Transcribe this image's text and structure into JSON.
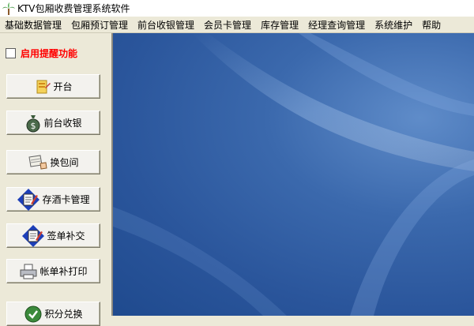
{
  "window": {
    "title": "KTV包厢收费管理系统软件"
  },
  "menu": [
    "基础数据管理",
    "包厢预订管理",
    "前台收银管理",
    "会员卡管理",
    "库存管理",
    "经理查询管理",
    "系统维护",
    "帮助"
  ],
  "sidebar": {
    "reminder_label": "启用提醒功能",
    "reminder_checked": false,
    "buttons": [
      {
        "label": "开台",
        "icon": "open-table-icon"
      },
      {
        "label": "前台收银",
        "icon": "money-bag-icon"
      },
      {
        "label": "换包间",
        "icon": "scroll-hand-icon"
      },
      {
        "label": "存酒卡管理",
        "icon": "card-edit-icon"
      },
      {
        "label": "签单补交",
        "icon": "card-edit-icon"
      },
      {
        "label": "帐单补打印",
        "icon": "printer-icon"
      },
      {
        "label": "积分兑换",
        "icon": "exchange-icon"
      }
    ]
  },
  "colors": {
    "reminder_text": "#ff0000",
    "desktop_blue": "#2a5aa0"
  }
}
